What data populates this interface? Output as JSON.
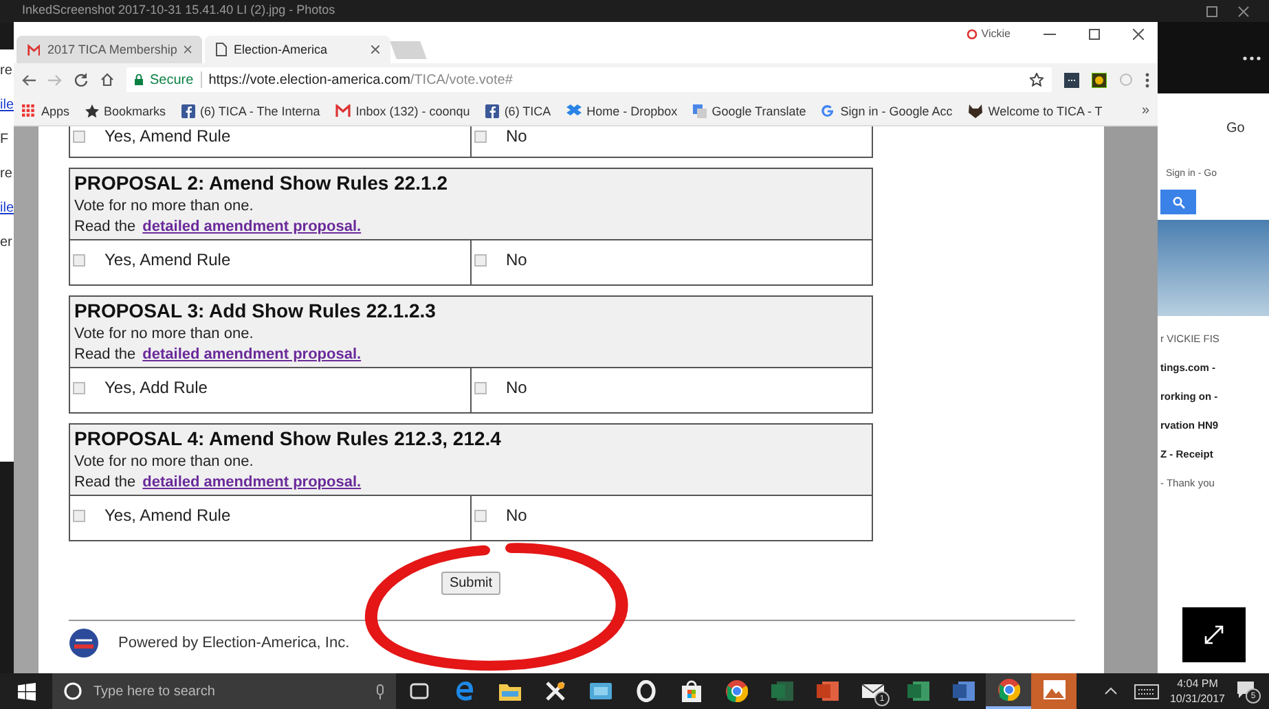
{
  "photos_window": {
    "title": "InkedScreenshot 2017-10-31 15.41.40 LI (2).jpg - Photos"
  },
  "left_window": {
    "fragments": [
      {
        "text": "re",
        "kind": "text"
      },
      {
        "text": "ile",
        "kind": "link"
      },
      {
        "text": "F",
        "kind": "text"
      },
      {
        "text": "re",
        "kind": "text"
      },
      {
        "text": "ile",
        "kind": "link"
      },
      {
        "text": "er",
        "kind": "text"
      }
    ]
  },
  "browser": {
    "tabs": [
      {
        "title": "2017 TICA Membership",
        "kind": "mail",
        "selected": false
      },
      {
        "title": "Election-America",
        "kind": "page",
        "selected": true
      }
    ],
    "profile": "Vickie",
    "security": "Secure",
    "url_host": "https://vote.election-america.com",
    "url_path": "/TICA/vote.vote#",
    "bookmarks": [
      {
        "label": "Apps",
        "kind": "grid"
      },
      {
        "label": "Bookmarks",
        "kind": "star"
      },
      {
        "label": "(6) TICA - The Interna",
        "kind": "square-f"
      },
      {
        "label": "Inbox (132) - coonqu",
        "kind": "mail"
      },
      {
        "label": "(6) TICA",
        "kind": "square-f"
      },
      {
        "label": "Home - Dropbox",
        "kind": "box"
      },
      {
        "label": "Google Translate",
        "kind": "translate"
      },
      {
        "label": "Sign in - Google Acc",
        "kind": "g"
      },
      {
        "label": "Welcome to TICA - T",
        "kind": "cat"
      }
    ],
    "more": "»"
  },
  "ballot": {
    "partial_options": [
      {
        "label": "Yes, Amend Rule",
        "checked": false
      },
      {
        "label": "No",
        "checked": false
      }
    ],
    "proposals": [
      {
        "title": "PROPOSAL 2: Amend Show Rules 22.1.2",
        "instruction": "Vote for no more than one.",
        "read_prefix": "Read the",
        "link": "detailed amendment proposal.",
        "options": [
          {
            "label": "Yes, Amend Rule",
            "checked": false
          },
          {
            "label": "No",
            "checked": false
          }
        ]
      },
      {
        "title": "PROPOSAL 3: Add Show Rules 22.1.2.3",
        "instruction": "Vote for no more than one.",
        "read_prefix": "Read the",
        "link": "detailed amendment proposal.",
        "options": [
          {
            "label": "Yes, Add Rule",
            "checked": false
          },
          {
            "label": "No",
            "checked": false
          }
        ]
      },
      {
        "title": "PROPOSAL 4: Amend Show Rules 212.3, 212.4",
        "instruction": "Vote for no more than one.",
        "read_prefix": "Read the",
        "link": "detailed amendment proposal.",
        "options": [
          {
            "label": "Yes, Amend Rule",
            "checked": false
          },
          {
            "label": "No",
            "checked": false
          }
        ]
      }
    ],
    "submit": "Submit",
    "footer": "Powered by Election-America, Inc."
  },
  "side_panel": {
    "top": "Go",
    "search_hint": "Sign in - Go",
    "fragments": [
      {
        "text": "r VICKIE FIS",
        "bold": false
      },
      {
        "text": "tings.com -",
        "bold": true
      },
      {
        "text": "rorking on -",
        "bold": true
      },
      {
        "text": "rvation HN9",
        "bold": true
      },
      {
        "text": "Z - Receipt",
        "bold": true
      },
      {
        "text": "- Thank you",
        "bold": false
      }
    ]
  },
  "taskbar": {
    "search_placeholder": "Type here to search",
    "apps": [
      {
        "kind": "taskview",
        "active": false
      },
      {
        "kind": "edge",
        "active": false
      },
      {
        "kind": "folder",
        "active": false
      },
      {
        "kind": "tools",
        "active": false
      },
      {
        "kind": "card",
        "active": false
      },
      {
        "kind": "ring",
        "active": false
      },
      {
        "kind": "bag",
        "active": false
      },
      {
        "kind": "chrome",
        "active": false
      },
      {
        "kind": "doc-green",
        "active": false
      },
      {
        "kind": "doc-red",
        "active": false
      },
      {
        "kind": "mail",
        "active": false,
        "badge": "1"
      },
      {
        "kind": "sheet",
        "active": false
      },
      {
        "kind": "doc-blue",
        "active": false
      },
      {
        "kind": "chrome",
        "active": true
      },
      {
        "kind": "photos",
        "active": true
      }
    ],
    "time": "4:04 PM",
    "date": "10/31/2017",
    "notifications": "5"
  }
}
